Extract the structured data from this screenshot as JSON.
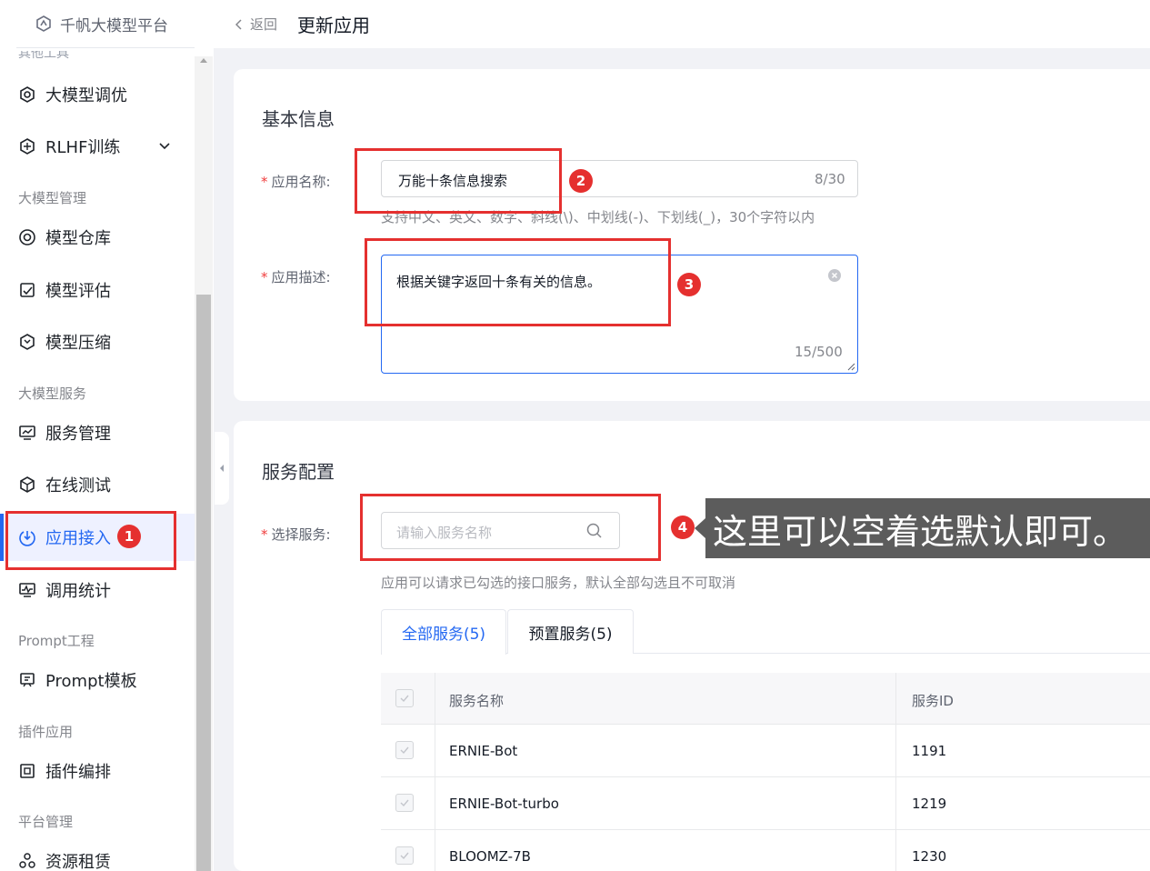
{
  "brand": {
    "name": "千帆大模型平台",
    "icon": "hexagon-logo-icon"
  },
  "sidebar": {
    "cut_off_label": "其他工具",
    "items": [
      {
        "label": "大模型调优",
        "icon": "tuning-icon"
      },
      {
        "label": "RLHF训练",
        "icon": "rlhf-icon",
        "expandable": true
      },
      {
        "label": "模型仓库",
        "icon": "repository-icon"
      },
      {
        "label": "模型评估",
        "icon": "evaluate-icon"
      },
      {
        "label": "模型压缩",
        "icon": "compress-icon"
      },
      {
        "label": "服务管理",
        "icon": "service-icon"
      },
      {
        "label": "在线测试",
        "icon": "test-icon"
      },
      {
        "label": "应用接入",
        "icon": "app-access-icon",
        "active": true
      },
      {
        "label": "调用统计",
        "icon": "stats-icon"
      },
      {
        "label": "Prompt模板",
        "icon": "prompt-icon"
      },
      {
        "label": "插件编排",
        "icon": "plugin-icon"
      },
      {
        "label": "资源租赁",
        "icon": "resource-icon"
      }
    ],
    "groups": [
      "大模型管理",
      "大模型服务",
      "Prompt工程",
      "插件应用",
      "平台管理"
    ]
  },
  "header": {
    "back_label": "返回",
    "title": "更新应用"
  },
  "basic_info": {
    "section_title": "基本信息",
    "name_label": "应用名称:",
    "name_value": "万能十条信息搜索",
    "name_counter": "8/30",
    "name_hint": "支持中文、英文、数字、斜线(\\)、中划线(-)、下划线(_)，30个字符以内",
    "desc_label": "应用描述:",
    "desc_value": "根据关键字返回十条有关的信息。",
    "desc_counter": "15/500"
  },
  "service_config": {
    "section_title": "服务配置",
    "select_label": "选择服务:",
    "search_placeholder": "请输入服务名称",
    "hint": "应用可以请求已勾选的接口服务，默认全部勾选且不可取消",
    "tabs": [
      {
        "label": "全部服务(5)",
        "active": true
      },
      {
        "label": "预置服务(5)",
        "active": false
      }
    ],
    "table": {
      "headers": [
        "服务名称",
        "服务ID"
      ],
      "rows": [
        {
          "name": "ERNIE-Bot",
          "id": "1191"
        },
        {
          "name": "ERNIE-Bot-turbo",
          "id": "1219"
        },
        {
          "name": "BLOOMZ-7B",
          "id": "1230"
        }
      ]
    }
  },
  "annotations": {
    "badges": [
      "1",
      "2",
      "3",
      "4"
    ],
    "note": "这里可以空着选默认即可。"
  },
  "colors": {
    "accent": "#2468f2",
    "annotation_red": "#e5302f",
    "note_bg": "#5c5c5c",
    "page_bg": "#f1f2f6"
  }
}
